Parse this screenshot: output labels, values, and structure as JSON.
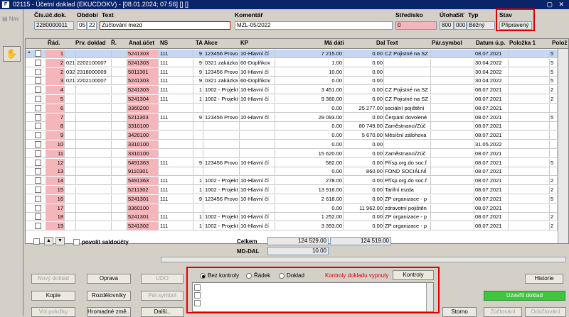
{
  "window": {
    "title": "02115 - Účetní doklad (EKUCDOKV) - [08.01.2024; 07:56] [] []",
    "controls": "▢ ✕"
  },
  "nav_label": "Nav",
  "header": {
    "labels": {
      "doc_no": "Čís.úč.dok.",
      "period": "Období",
      "text": "Text",
      "comment": "Komentář",
      "center": "Středisko",
      "loan": "Úloha",
      "net": "Síť",
      "type": "Typ",
      "status": "Stav"
    },
    "values": {
      "doc_no": "2280000011",
      "period_a": "05",
      "period_b": "22",
      "text": "Zúčtování mezd",
      "comment": "MZL-05/2022",
      "center": "0",
      "loan": "800",
      "net": "000",
      "type": "Běžný",
      "status": "Připravený"
    }
  },
  "grid": {
    "columns": [
      "Řád.",
      "Prv. doklad",
      "Ř.",
      "Anal.účet",
      "NS",
      "TA Akce",
      "KP",
      "Má dáti",
      "Dal Text",
      "Pár.symbol",
      "Datum ú.p.",
      "Položka 1",
      "Polož"
    ],
    "rows": [
      {
        "n": "1",
        "a": "",
        "b": "",
        "r": "",
        "acc": "5241303",
        "ns": "111",
        "ta": "9",
        "akce": "123456 Provo",
        "kp": "10-Hlavní čí",
        "md": "7 215.00",
        "dal": "0.00",
        "txt": "CZ Pojistné na SZ",
        "sym": "",
        "dat": "08.07.2021",
        "p1": "",
        "p2": "5"
      },
      {
        "n": "2",
        "a": "021",
        "b": "2202100007",
        "r": "",
        "acc": "5241303",
        "ns": "111",
        "ta": "9",
        "akce": "0321 zakázka",
        "kp": "60-Doplňkov",
        "md": "1.00",
        "dal": "0.00",
        "txt": "",
        "sym": "",
        "dat": "30.04.2022",
        "p1": "",
        "p2": "5"
      },
      {
        "n": "2",
        "a": "032",
        "b": "2318000009",
        "r": "",
        "acc": "5011301",
        "ns": "111",
        "ta": "9",
        "akce": "123456 Provo",
        "kp": "10-Hlavní čí",
        "md": "10.00",
        "dal": "0.00",
        "txt": "",
        "sym": "",
        "dat": "30.04.2022",
        "p1": "",
        "p2": "5"
      },
      {
        "n": "3",
        "a": "021",
        "b": "2202100007",
        "r": "",
        "acc": "5241303",
        "ns": "111",
        "ta": "9",
        "akce": "0321 zakázka",
        "kp": "60-Doplňkov",
        "md": "0.00",
        "dal": "0.00",
        "txt": "",
        "sym": "",
        "dat": "30.04.2022",
        "p1": "",
        "p2": "5"
      },
      {
        "n": "4",
        "a": "",
        "b": "",
        "r": "",
        "acc": "5241303",
        "ns": "111",
        "ta": "1",
        "akce": "1002 - Projekt",
        "kp": "10-Hlavní čí",
        "md": "3 451.00",
        "dal": "0.00",
        "txt": "CZ Pojistné na SZ",
        "sym": "",
        "dat": "08.07.2021",
        "p1": "",
        "p2": "2"
      },
      {
        "n": "5",
        "a": "",
        "b": "",
        "r": "",
        "acc": "5241304",
        "ns": "111",
        "ta": "1",
        "akce": "1002 - Projekt",
        "kp": "10-Hlavní čí",
        "md": "9 360.00",
        "dal": "0.00",
        "txt": "CZ Pojistné na SZ",
        "sym": "",
        "dat": "08.07.2021",
        "p1": "",
        "p2": "2"
      },
      {
        "n": "6",
        "a": "",
        "b": "",
        "r": "",
        "acc": "3360200",
        "ns": "",
        "ta": "",
        "akce": "",
        "kp": "",
        "md": "0.00",
        "dal": "25 277.00",
        "txt": "sociální pojištění",
        "sym": "",
        "dat": "08.07.2021",
        "p1": "",
        "p2": ""
      },
      {
        "n": "7",
        "a": "",
        "b": "",
        "r": "",
        "acc": "5211303",
        "ns": "111",
        "ta": "9",
        "akce": "123456 Provo",
        "kp": "10-Hlavní čí",
        "md": "29 093.00",
        "dal": "0.00",
        "txt": "Čerpání dovolené",
        "sym": "",
        "dat": "08.07.2021",
        "p1": "",
        "p2": "5"
      },
      {
        "n": "8",
        "a": "",
        "b": "",
        "r": "",
        "acc": "3310100",
        "ns": "",
        "ta": "",
        "akce": "",
        "kp": "",
        "md": "0.00",
        "dal": "80 749.00",
        "txt": "Zaměstnanci/Zúč",
        "sym": "",
        "dat": "08.07.2021",
        "p1": "",
        "p2": ""
      },
      {
        "n": "9",
        "a": "",
        "b": "",
        "r": "",
        "acc": "3420100",
        "ns": "",
        "ta": "",
        "akce": "",
        "kp": "",
        "md": "0.00",
        "dal": "5 670.00",
        "txt": "Měsíční zálohová",
        "sym": "",
        "dat": "08.07.2021",
        "p1": "",
        "p2": ""
      },
      {
        "n": "10",
        "a": "",
        "b": "",
        "r": "",
        "acc": "3310100",
        "ns": "",
        "ta": "",
        "akce": "",
        "kp": "",
        "md": "0.00",
        "dal": "0.00",
        "txt": "",
        "sym": "",
        "dat": "31.05.2022",
        "p1": "",
        "p2": ""
      },
      {
        "n": "11",
        "a": "",
        "b": "",
        "r": "",
        "acc": "3310100",
        "ns": "",
        "ta": "",
        "akce": "",
        "kp": "",
        "md": "15 620.00",
        "dal": "0.00",
        "txt": "Zaměstnanci/Zúč",
        "sym": "",
        "dat": "08.07.2021",
        "p1": "",
        "p2": ""
      },
      {
        "n": "12",
        "a": "",
        "b": "",
        "r": "",
        "acc": "5491363",
        "ns": "111",
        "ta": "9",
        "akce": "123456 Provo",
        "kp": "10-Hlavní čí",
        "md": "582.00",
        "dal": "0.00",
        "txt": "Přísp.org.do soc.f",
        "sym": "",
        "dat": "08.07.2021",
        "p1": "",
        "p2": "5"
      },
      {
        "n": "13",
        "a": "",
        "b": "",
        "r": "",
        "acc": "9110301",
        "ns": "",
        "ta": "",
        "akce": "",
        "kp": "",
        "md": "0.00",
        "dal": "860.00",
        "txt": "FOND SOCIÁLNÍ",
        "sym": "",
        "dat": "08.07.2021",
        "p1": "",
        "p2": ""
      },
      {
        "n": "14",
        "a": "",
        "b": "",
        "r": "",
        "acc": "5491363",
        "ns": "111",
        "ta": "1",
        "akce": "1002 - Projekt",
        "kp": "10-Hlavní čí",
        "md": "278.00",
        "dal": "0.00",
        "txt": "Přísp.org.do soc.f",
        "sym": "",
        "dat": "08.07.2021",
        "p1": "",
        "p2": "2"
      },
      {
        "n": "15",
        "a": "",
        "b": "",
        "r": "",
        "acc": "5211302",
        "ns": "111",
        "ta": "1",
        "akce": "1002 - Projekt",
        "kp": "10-Hlavní čí",
        "md": "13 916.00",
        "dal": "0.00",
        "txt": "Tarifní mzda",
        "sym": "",
        "dat": "08.07.2021",
        "p1": "",
        "p2": "2"
      },
      {
        "n": "16",
        "a": "",
        "b": "",
        "r": "",
        "acc": "5241301",
        "ns": "111",
        "ta": "9",
        "akce": "123456 Provo",
        "kp": "10-Hlavní čí",
        "md": "2 618.00",
        "dal": "0.00",
        "txt": "ZP organizace - p",
        "sym": "",
        "dat": "08.07.2021",
        "p1": "",
        "p2": "5"
      },
      {
        "n": "17",
        "a": "",
        "b": "",
        "r": "",
        "acc": "3360100",
        "ns": "",
        "ta": "",
        "akce": "",
        "kp": "",
        "md": "0.00",
        "dal": "11 962.00",
        "txt": "zdravotní pojištěn",
        "sym": "",
        "dat": "08.07.2021",
        "p1": "",
        "p2": ""
      },
      {
        "n": "18",
        "a": "",
        "b": "",
        "r": "",
        "acc": "5241301",
        "ns": "111",
        "ta": "1",
        "akce": "1002 - Projekt",
        "kp": "10-Hlavní čí",
        "md": "1 252.00",
        "dal": "0.00",
        "txt": "ZP organizace - p",
        "sym": "",
        "dat": "08.07.2021",
        "p1": "",
        "p2": "2"
      },
      {
        "n": "19",
        "a": "",
        "b": "",
        "r": "",
        "acc": "5241302",
        "ns": "111",
        "ta": "1",
        "akce": "1002 - Projekt",
        "kp": "10-Hlavní čí",
        "md": "3 393.00",
        "dal": "0.00",
        "txt": "ZP organizace - p",
        "sym": "",
        "dat": "08.07.2021",
        "p1": "",
        "p2": "2"
      }
    ]
  },
  "footer": {
    "povolit": "povolit saldoúčty",
    "celkem_label": "Celkem",
    "celkem_md": "124 529.00",
    "celkem_dal": "124 519.00",
    "mddal_label": "MD-DAL",
    "mddal_value": "10.00"
  },
  "buttons": {
    "novy": "Nový doklad",
    "oprava": "Oprava",
    "udo": "UDO",
    "kopie": "Kopie",
    "rozdel": "Rozdělovníky",
    "par": "Pár.symbol",
    "volpol": "Vol.položky",
    "hromadne": "Hromadné změ...",
    "dalsi": "Další..",
    "historie": "Historie",
    "uzavrit": "Uzavřít doklad",
    "storno": "Storno",
    "zuctovani": "Zúčtování",
    "odzuctovani": "Odúčtování"
  },
  "controls_panel": {
    "opt1": "Bez kontroly",
    "opt2": "Řádek",
    "opt3": "Doklad",
    "warning": "Kontroly dokladu vypnuty",
    "btn": "Kontroly"
  },
  "colors": {
    "title": "#0a246a",
    "pink": "#f4b6bb",
    "selected": "#c5d7f2",
    "highlight": "#e00000",
    "green": "#3fc63f"
  }
}
